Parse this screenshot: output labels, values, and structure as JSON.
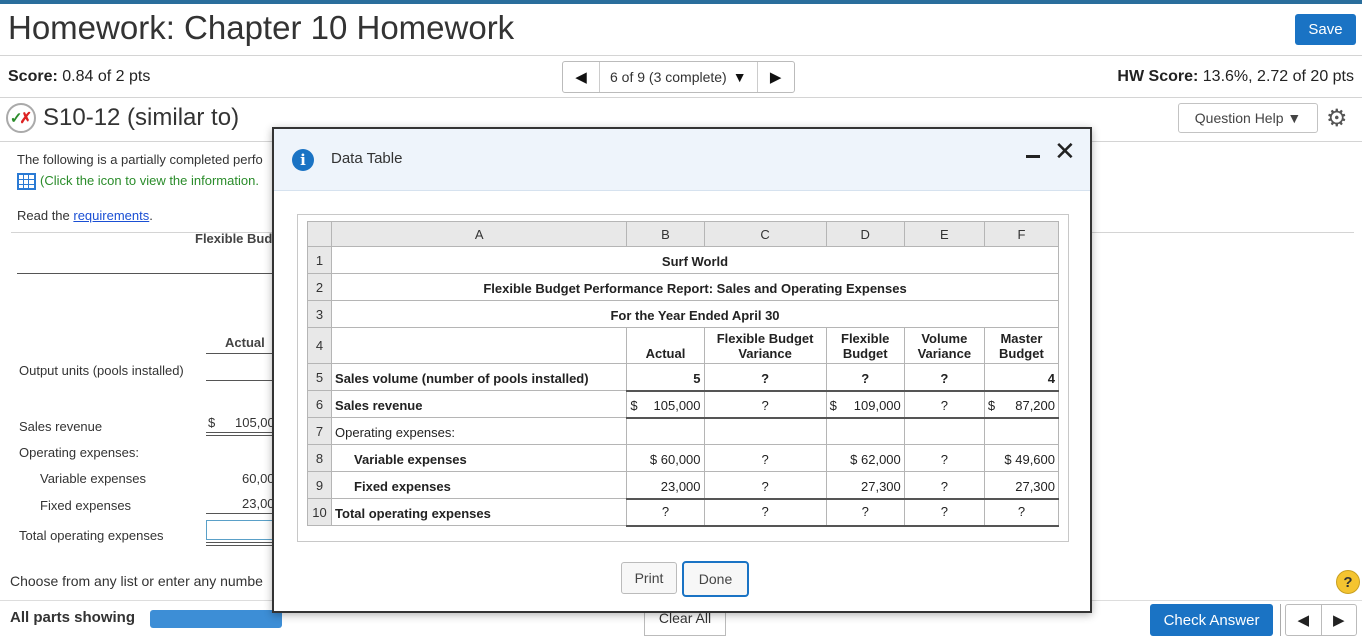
{
  "header": {
    "title": "Homework: Chapter 10 Homework",
    "save_label": "Save"
  },
  "score": {
    "label": "Score:",
    "value": "0.84 of 2 pts"
  },
  "nav": {
    "position": "6 of 9 (3 complete)"
  },
  "hw_score": {
    "label": "HW Score:",
    "value": "13.6%, 2.72 of 20 pts"
  },
  "question": {
    "name": "S10-12 (similar to)",
    "help_label": "Question Help"
  },
  "body": {
    "intro": "The following is a partially completed perfo",
    "click_icon": "(Click the icon to view the information.",
    "read_prefix": "Read the ",
    "requirements_link": "requirements",
    "read_suffix": ".",
    "flex_header": "Flexible Bud",
    "actual_header": "Actual",
    "rows": {
      "output_units": "Output units (pools installed)",
      "sales_revenue": "Sales revenue",
      "sales_dollar": "$",
      "sales_value": "105,00",
      "opex": "Operating expenses:",
      "variable": "Variable expenses",
      "variable_value": "60,00",
      "fixed": "Fixed expenses",
      "fixed_value": "23,00",
      "total": "Total operating expenses"
    },
    "choose_text": "Choose from any list or enter any numbe"
  },
  "footer": {
    "all_parts": "All parts showing",
    "clear_all": "Clear All",
    "check_answer": "Check Answer"
  },
  "modal": {
    "title": "Data Table",
    "print_label": "Print",
    "done_label": "Done",
    "columns": [
      "A",
      "B",
      "C",
      "D",
      "E",
      "F"
    ],
    "company": "Surf World",
    "report_title": "Flexible Budget Performance Report: Sales and Operating Expenses",
    "period": "For the Year Ended April 30",
    "col_headers": {
      "actual": "Actual",
      "fbv": "Flexible Budget Variance",
      "flex": "Flexible Budget",
      "vv": "Volume Variance",
      "master": "Master Budget"
    },
    "rows": [
      {
        "num": "5",
        "label": "Sales volume (number of pools installed)",
        "actual": "5",
        "fbv": "?",
        "flex": "?",
        "vv": "?",
        "master": "4"
      },
      {
        "num": "6",
        "label": "Sales revenue",
        "cur": "$",
        "actual": "105,000",
        "fbv": "?",
        "flex": "109,000",
        "vv": "?",
        "master": "87,200"
      },
      {
        "num": "7",
        "label": "Operating expenses:"
      },
      {
        "num": "8",
        "label": "Variable expenses",
        "cur": "$",
        "actual": "60,000",
        "fbv": "?",
        "flex": "62,000",
        "vv": "?",
        "master": "49,600"
      },
      {
        "num": "9",
        "label": "Fixed expenses",
        "actual": "23,000",
        "fbv": "?",
        "flex": "27,300",
        "vv": "?",
        "master": "27,300"
      },
      {
        "num": "10",
        "label": "Total operating expenses",
        "actual": "?",
        "fbv": "?",
        "flex": "?",
        "vv": "?",
        "master": "?"
      }
    ]
  }
}
